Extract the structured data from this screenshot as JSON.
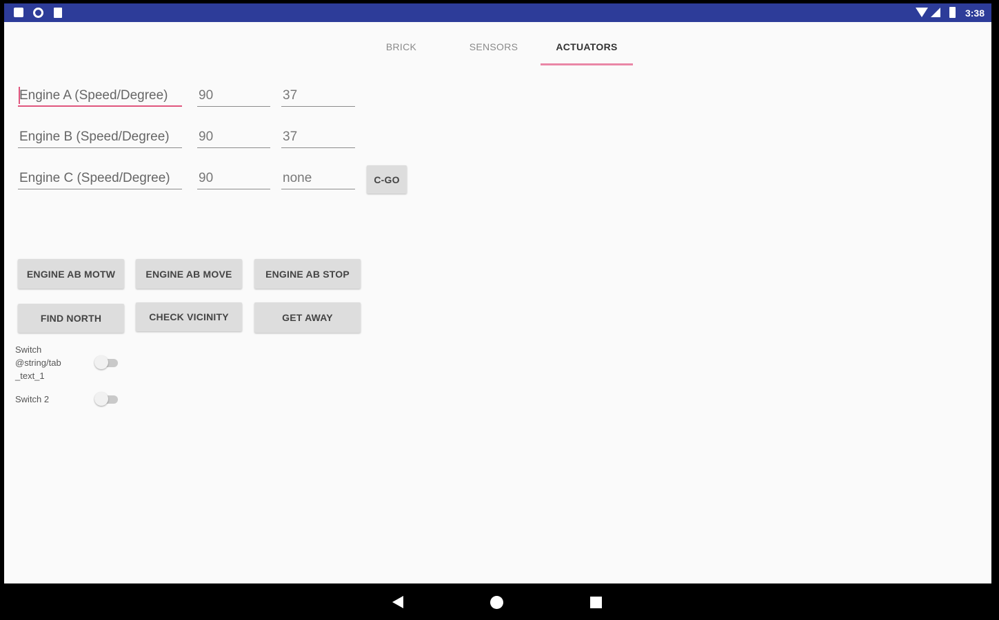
{
  "status_bar": {
    "time": "3:38",
    "left_icons": [
      "notification-icon",
      "sync-icon",
      "sd-card-icon"
    ],
    "right_icons": [
      "wifi-icon",
      "signal-icon",
      "battery-icon"
    ],
    "background": "#2d3c99"
  },
  "tabs": [
    {
      "label": "BRICK",
      "active": false
    },
    {
      "label": "SENSORS",
      "active": false
    },
    {
      "label": "ACTUATORS",
      "active": true
    }
  ],
  "accent_color": "#ea86a6",
  "engines": [
    {
      "label": "Engine A (Speed/Degree)",
      "speed": "90",
      "degree": "37"
    },
    {
      "label": "Engine B (Speed/Degree)",
      "speed": "90",
      "degree": "37"
    },
    {
      "label": "Engine C (Speed/Degree)",
      "speed": "90",
      "degree": "none",
      "button": "C-GO"
    }
  ],
  "buttons": {
    "engine_ab_motw": "ENGINE AB MOTW",
    "engine_ab_move": "ENGINE AB MOVE",
    "engine_ab_stop": "ENGINE AB STOP",
    "find_north": "FIND NORTH",
    "check_vicinity": "CHECK VICINITY",
    "get_away": "GET AWAY"
  },
  "switches": [
    {
      "label": "Switch\n@string/tab\n_text_1",
      "on": false
    },
    {
      "label": "Switch 2",
      "on": false
    }
  ],
  "nav_bar": {
    "icons": [
      "back-icon",
      "home-icon",
      "recents-icon"
    ]
  }
}
